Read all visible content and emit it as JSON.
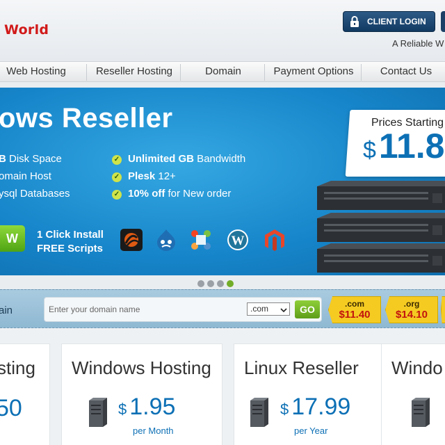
{
  "header": {
    "logo_text": "World",
    "client_login_label": "CLIENT LOGIN",
    "tagline": "A Reliable W"
  },
  "nav": {
    "items": [
      {
        "label": "Web Hosting"
      },
      {
        "label": "Reseller Hosting"
      },
      {
        "label": "Domain"
      },
      {
        "label": "Payment Options"
      },
      {
        "label": "Contact Us"
      }
    ]
  },
  "banner": {
    "title": "ows Reseller",
    "features_left": [
      {
        "bold": "B",
        "text": " Disk Space"
      },
      {
        "bold": "",
        "text": "omain Host"
      },
      {
        "bold": "",
        "text": "ysql Databases"
      }
    ],
    "features_right": [
      {
        "bold": "Unlimited GB",
        "text": " Bandwidth"
      },
      {
        "bold": "Plesk",
        "text": " 12+"
      },
      {
        "bold": "10% off",
        "text": " for New order"
      }
    ],
    "order_button_label": "W",
    "install_line1": "1 Click Install",
    "install_line2": "FREE Scripts",
    "app_icons": [
      "forum-app-icon",
      "drupal-icon",
      "joomla-icon",
      "wordpress-icon",
      "magento-icon"
    ],
    "price_label": "Prices Starting",
    "price_currency": "$",
    "price_value": "11.8",
    "slider": {
      "total": 4,
      "active_index": 3
    }
  },
  "domain_search": {
    "label": "ain",
    "placeholder": "Enter your domain name",
    "selected_tld": ".com",
    "go_label": "GO",
    "tld_prices": [
      {
        "tld": ".com",
        "price": "$11.40"
      },
      {
        "tld": ".org",
        "price": "$14.10"
      }
    ]
  },
  "plans": [
    {
      "title": "sting",
      "price": "50",
      "currency": "",
      "period": ""
    },
    {
      "title": "Windows Hosting",
      "price": "1.95",
      "currency": "$",
      "period": "per Month"
    },
    {
      "title": "Linux Reseller",
      "price": "17.99",
      "currency": "$",
      "period": "per Year"
    },
    {
      "title": "Windo",
      "price": "",
      "currency": "",
      "period": ""
    }
  ],
  "colors": {
    "brand_red": "#d11a1a",
    "primary_blue": "#0d70b5",
    "login_bg": "#1b3f66",
    "accent_green": "#73ad28",
    "tag_yellow": "#f5cb22"
  }
}
